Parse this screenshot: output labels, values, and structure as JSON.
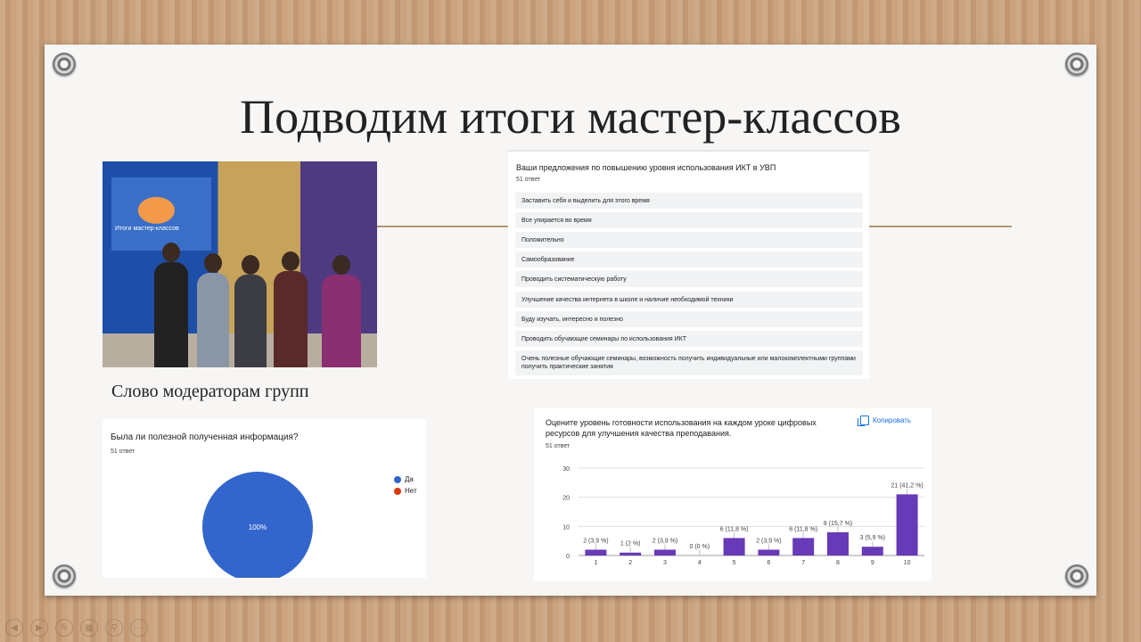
{
  "slide": {
    "title": "Подводим итоги мастер-классов",
    "photo_screen_caption": "Итоги мастер-классов",
    "caption": "Слово модераторам групп"
  },
  "suggestions_card": {
    "question": "Ваши предложения по повышению уровня использования ИКТ в УВП",
    "count": "51 ответ",
    "answers": [
      "Заставить себя и выделить для этого время",
      "Все упирается во время",
      "Положительно",
      "Самообразование",
      "Проводить систематическую работу",
      "Улучшение качества интернета в школе и наличие необходимой техники",
      "Буду изучать, интересно и полезно",
      "Проводить обучающие семинары по использования ИКТ",
      "Очень полезные обучающие семинары, возможность получить индивидуальные или малокомплектными группами получить практические занятия"
    ]
  },
  "pie_card": {
    "question": "Была ли полезной полученная информация?",
    "count": "51 ответ",
    "slice_label": "100%",
    "legend": [
      {
        "label": "Да",
        "color": "#3366cc"
      },
      {
        "label": "Нет",
        "color": "#dc3912"
      }
    ]
  },
  "bar_card": {
    "question_line1": "Оцените уровень готовности использования на каждом уроке цифровых",
    "question_line2": "ресурсов для улучшения качества преподавания.",
    "count": "51 ответ",
    "copy_label": "Копировать"
  },
  "colors": {
    "pie_yes": "#3366cc",
    "bar": "#673ab7",
    "slide_bg": "#f7f6f4"
  },
  "chart_data": [
    {
      "type": "pie",
      "categories": [
        "Да",
        "Нет"
      ],
      "values": [
        100,
        0
      ],
      "data_labels": [
        "100%"
      ]
    },
    {
      "type": "bar",
      "categories": [
        "1",
        "2",
        "3",
        "4",
        "5",
        "6",
        "7",
        "8",
        "9",
        "10"
      ],
      "values": [
        2,
        1,
        2,
        0,
        6,
        2,
        6,
        8,
        3,
        21
      ],
      "data_labels": [
        "2 (3,9 %)",
        "1 (2 %)",
        "2 (3,9 %)",
        "0 (0 %)",
        "6 (11,8 %)",
        "2 (3,9 %)",
        "6 (11,8 %)",
        "8 (15,7 %)",
        "3 (5,9 %)",
        "21 (41,2 %)"
      ],
      "y_ticks": [
        "0",
        "10",
        "20",
        "30"
      ],
      "ylim": [
        0,
        30
      ],
      "grid": true
    }
  ]
}
